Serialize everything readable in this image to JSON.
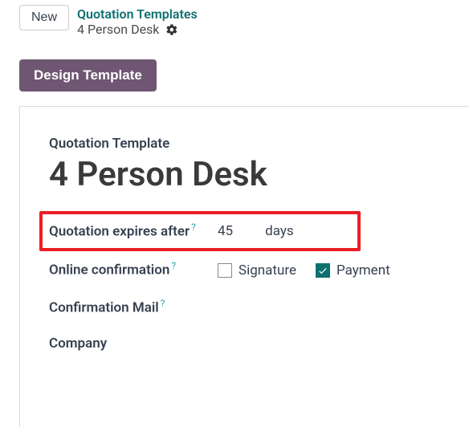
{
  "topbar": {
    "new_label": "New"
  },
  "breadcrumb": {
    "parent": "Quotation Templates",
    "current": "4 Person Desk"
  },
  "design_button": "Design Template",
  "section": {
    "label": "Quotation Template",
    "title": "4 Person Desk"
  },
  "fields": {
    "expires": {
      "label": "Quotation expires after",
      "value": "45",
      "unit": "days"
    },
    "online_confirmation": {
      "label": "Online confirmation",
      "signature_label": "Signature",
      "signature_checked": false,
      "payment_label": "Payment",
      "payment_checked": true
    },
    "confirmation_mail": {
      "label": "Confirmation Mail"
    },
    "company": {
      "label": "Company"
    }
  }
}
